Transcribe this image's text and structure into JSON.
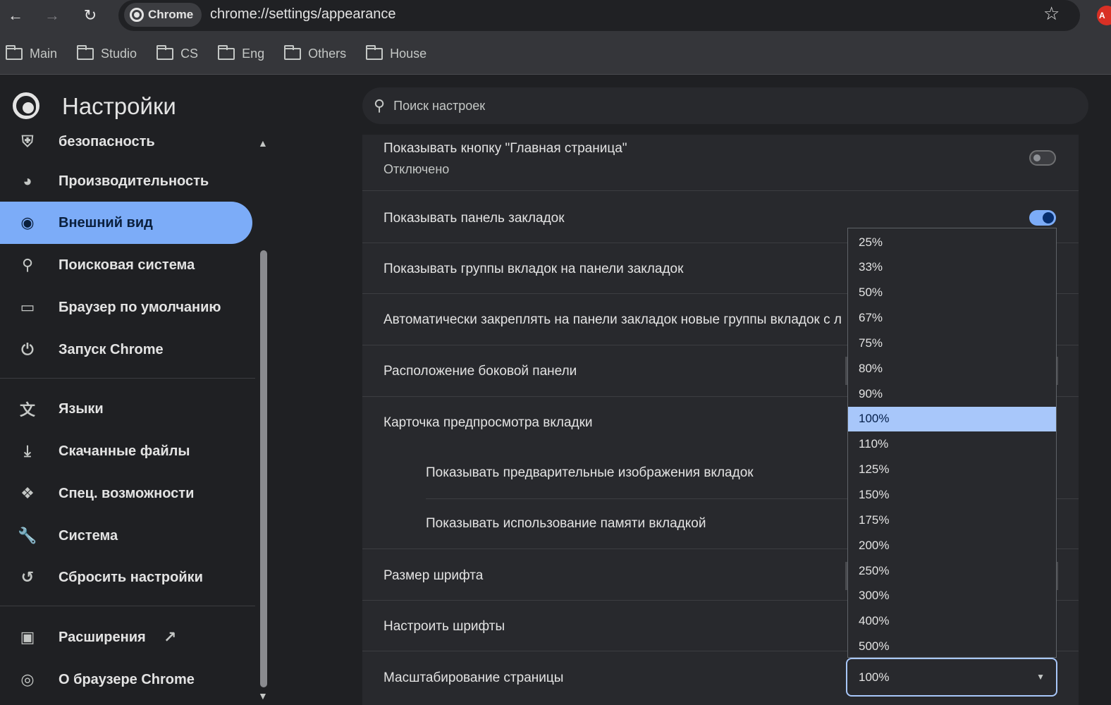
{
  "toolbar": {
    "chip_label": "Chrome",
    "url": "chrome://settings/appearance",
    "profile_badge": "A"
  },
  "bookmarks": [
    "Main",
    "Studio",
    "CS",
    "Eng",
    "Others",
    "House"
  ],
  "header": {
    "title": "Настройки",
    "search_placeholder": "Поиск настроек"
  },
  "sidebar": {
    "items": [
      {
        "label": "безопасность",
        "icon": "shield-icon"
      },
      {
        "label": "Производительность",
        "icon": "speedometer-icon"
      },
      {
        "label": "Внешний вид",
        "icon": "palette-icon"
      },
      {
        "label": "Поисковая система",
        "icon": "search-icon"
      },
      {
        "label": "Браузер по умолчанию",
        "icon": "browser-window-icon"
      },
      {
        "label": "Запуск Chrome",
        "icon": "power-icon"
      },
      {
        "label": "Языки",
        "icon": "translate-icon"
      },
      {
        "label": "Скачанные файлы",
        "icon": "download-icon"
      },
      {
        "label": "Спец. возможности",
        "icon": "accessibility-icon"
      },
      {
        "label": "Система",
        "icon": "wrench-icon"
      },
      {
        "label": "Сбросить настройки",
        "icon": "reset-icon"
      },
      {
        "label": "Расширения",
        "icon": "puzzle-icon"
      },
      {
        "label": "О браузере Chrome",
        "icon": "chrome-logo-icon"
      }
    ],
    "active_index": 2
  },
  "settings": {
    "home_button": {
      "label": "Показывать кнопку \"Главная страница\"",
      "sub": "Отключено",
      "enabled": false
    },
    "bookmarks_bar": {
      "label": "Показывать панель закладок",
      "enabled": true
    },
    "tab_groups_bar": {
      "label": "Показывать группы вкладок на панели закладок"
    },
    "auto_pin": {
      "label": "Автоматически закреплять на панели закладок новые группы вкладок с л"
    },
    "side_panel": {
      "label": "Расположение боковой панели"
    },
    "hover_card": {
      "label": "Карточка предпросмотра вкладки"
    },
    "hover_images": {
      "label": "Показывать предварительные изображения вкладок"
    },
    "hover_memory": {
      "label": "Показывать использование памяти вкладкой"
    },
    "font_size": {
      "label": "Размер шрифта"
    },
    "customize_fonts": {
      "label": "Настроить шрифты"
    },
    "page_zoom": {
      "label": "Масштабирование страницы",
      "value": "100%"
    }
  },
  "zoom_options": [
    "25%",
    "33%",
    "50%",
    "67%",
    "75%",
    "80%",
    "90%",
    "100%",
    "110%",
    "125%",
    "150%",
    "175%",
    "200%",
    "250%",
    "300%",
    "400%",
    "500%"
  ],
  "zoom_selected_index": 7,
  "colors": {
    "accent": "#7cacf8",
    "selection": "#a8c7fa",
    "background": "#1f2023",
    "card": "#28292d"
  }
}
